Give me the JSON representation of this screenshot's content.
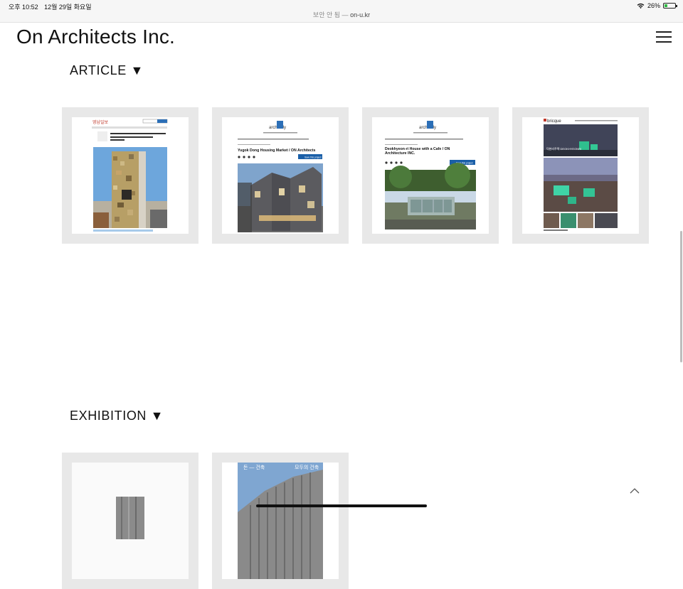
{
  "status_bar": {
    "time": "오후 10:52",
    "date": "12월 29일 화요일",
    "secure_label": "보안 안 됨 —",
    "url": "on-u.kr",
    "battery": "26%",
    "battery_level": 0.26
  },
  "header": {
    "logo_on": "On",
    "logo_rest": "Architects Inc.",
    "menu_icon": "hamburger-menu-icon"
  },
  "sections": {
    "article": {
      "title": "ARTICLE ▼"
    },
    "exhibition": {
      "title": "EXHIBITION ▼"
    }
  },
  "articles": [
    {
      "source": "영남일보",
      "headline": "재미 좋은건축대상 선정... 창의적 요소 대상"
    },
    {
      "source": "archdaily",
      "headline": "Yugok Dong Housing Market / ON Architects",
      "button": "Save this project"
    },
    {
      "source": "archdaily",
      "headline": "Deokhyeon-ri House with a Cafe / ON Architecture INC.",
      "button": "Save this project"
    },
    {
      "source": "bricque",
      "headline": "덕현리주택 DEOKHYEONRI"
    }
  ],
  "exhibitions": [
    {
      "label": ""
    },
    {
      "label_left": "돈 — 건축",
      "label_right": "모두의 건축"
    }
  ],
  "to_top_icon": "chevron-up-icon"
}
